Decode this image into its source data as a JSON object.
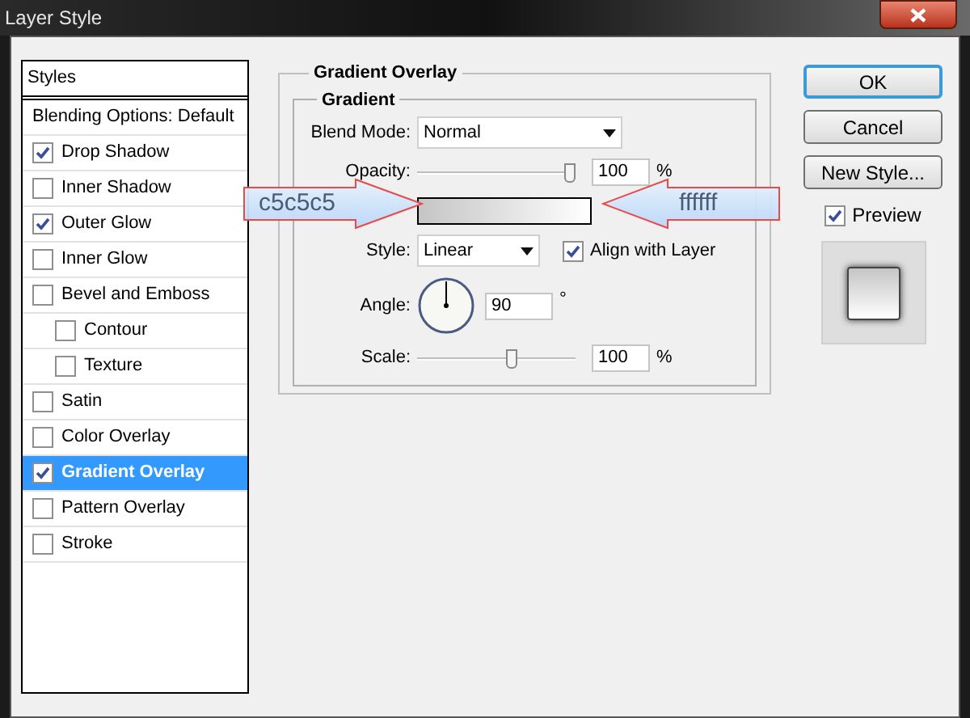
{
  "window": {
    "title": "Layer Style"
  },
  "sidebar": {
    "header": "Styles",
    "items": [
      {
        "kind": "plain",
        "label": "Blending Options: Default",
        "selected": false
      },
      {
        "kind": "effect",
        "label": "Drop Shadow",
        "checked": true,
        "selected": false
      },
      {
        "kind": "effect",
        "label": "Inner Shadow",
        "checked": false,
        "selected": false
      },
      {
        "kind": "effect",
        "label": "Outer Glow",
        "checked": true,
        "selected": false
      },
      {
        "kind": "effect",
        "label": "Inner Glow",
        "checked": false,
        "selected": false
      },
      {
        "kind": "effect",
        "label": "Bevel and Emboss",
        "checked": false,
        "selected": false,
        "children": [
          {
            "kind": "effect",
            "label": "Contour",
            "checked": false,
            "selected": false
          },
          {
            "kind": "effect",
            "label": "Texture",
            "checked": false,
            "selected": false
          }
        ]
      },
      {
        "kind": "effect",
        "label": "Satin",
        "checked": false,
        "selected": false
      },
      {
        "kind": "effect",
        "label": "Color Overlay",
        "checked": false,
        "selected": false
      },
      {
        "kind": "effect",
        "label": "Gradient Overlay",
        "checked": true,
        "selected": true
      },
      {
        "kind": "effect",
        "label": "Pattern Overlay",
        "checked": false,
        "selected": false
      },
      {
        "kind": "effect",
        "label": "Stroke",
        "checked": false,
        "selected": false
      }
    ]
  },
  "panel": {
    "title": "Gradient Overlay",
    "group": "Gradient",
    "blend_mode": {
      "label": "Blend Mode:",
      "value": "Normal"
    },
    "opacity": {
      "label": "Opacity:",
      "level": 0.97,
      "value": "100",
      "unit": "%"
    },
    "style": {
      "label": "Style:",
      "value": "Linear"
    },
    "align": {
      "label": "Align with Layer",
      "checked": true
    },
    "angle": {
      "label": "Angle:",
      "value": "90",
      "unit": "°"
    },
    "scale": {
      "label": "Scale:",
      "level": 0.6,
      "value": "100",
      "unit": "%"
    }
  },
  "callouts": [
    {
      "kind": "right",
      "text": "c5c5c5"
    },
    {
      "kind": "left",
      "text": "ffffff"
    }
  ],
  "buttons": [
    {
      "label": "OK",
      "default": true
    },
    {
      "label": "Cancel",
      "default": false
    },
    {
      "label": "New Style...",
      "default": false
    }
  ],
  "preview": {
    "label": "Preview",
    "checked": true
  }
}
